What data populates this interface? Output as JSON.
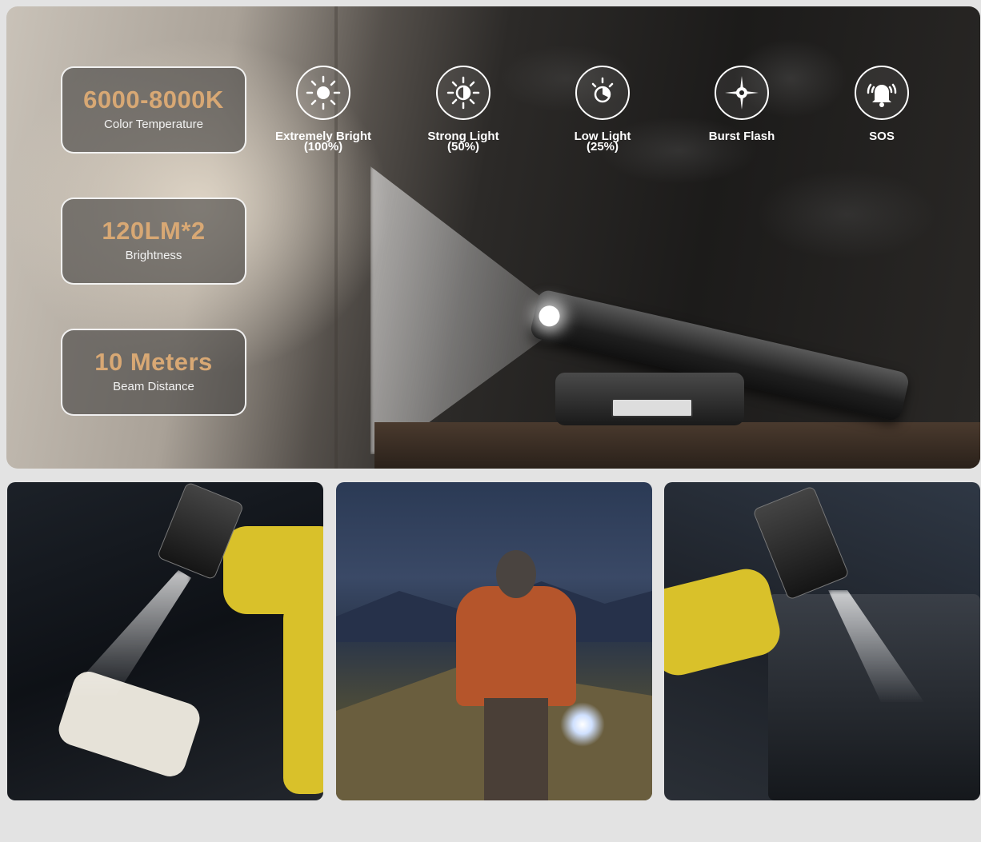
{
  "specs": [
    {
      "value": "6000-8000K",
      "label": "Color Temperature"
    },
    {
      "value": "120LM*2",
      "label": "Brightness"
    },
    {
      "value": "10 Meters",
      "label": "Beam Distance"
    }
  ],
  "modes": [
    {
      "icon": "sun-full-icon",
      "label": "Extremely Bright",
      "sub": "(100%)"
    },
    {
      "icon": "sun-half-icon",
      "label": "Strong Light",
      "sub": "(50%)"
    },
    {
      "icon": "sun-low-icon",
      "label": "Low Light",
      "sub": "(25%)"
    },
    {
      "icon": "burst-flash-icon",
      "label": "Burst Flash",
      "sub": ""
    },
    {
      "icon": "sos-bell-icon",
      "label": "SOS",
      "sub": ""
    }
  ],
  "colors": {
    "accent": "#d8a874",
    "background": "#e3e3e3"
  }
}
